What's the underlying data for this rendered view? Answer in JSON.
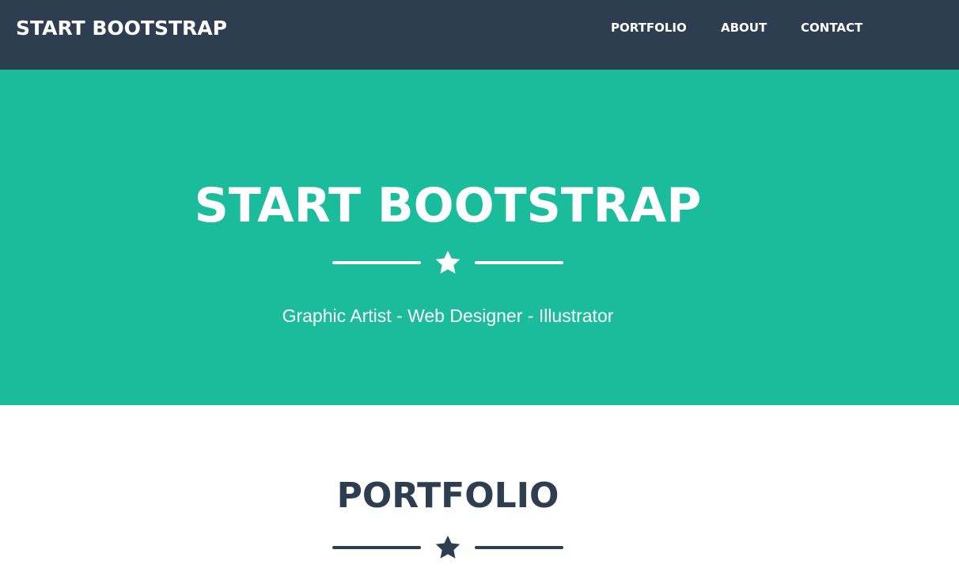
{
  "navbar": {
    "brand": "START BOOTSTRAP",
    "links": [
      "PORTFOLIO",
      "ABOUT",
      "CONTACT"
    ]
  },
  "hero": {
    "title": "START BOOTSTRAP",
    "subtitle": "Graphic Artist - Web Designer - Illustrator",
    "divider_icon": "star-icon"
  },
  "portfolio": {
    "title": "PORTFOLIO",
    "divider_icon": "star-icon"
  },
  "colors": {
    "navbar_bg": "#2c3e50",
    "hero_bg": "#1abc9c",
    "section_bg": "#ffffff",
    "heading_dark": "#2c3e50",
    "text_light": "#ffffff"
  }
}
